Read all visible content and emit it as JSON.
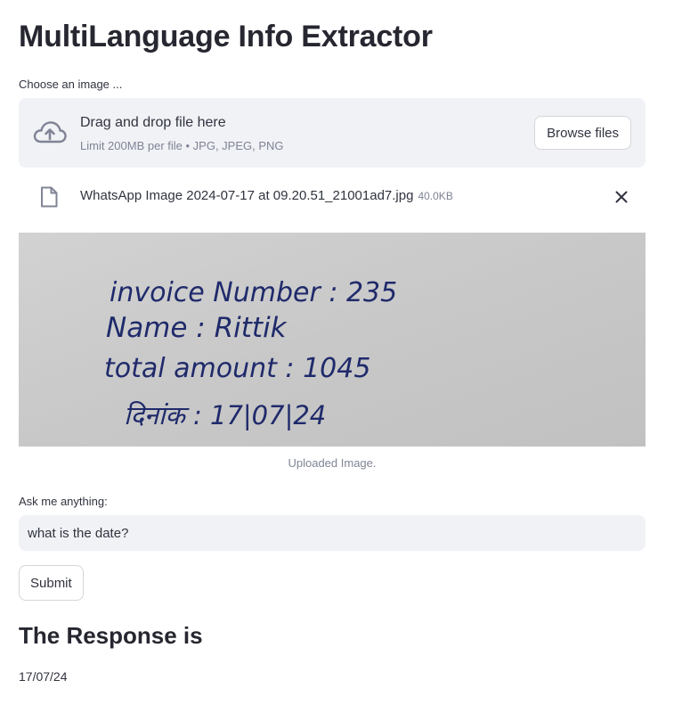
{
  "header": {
    "title": "MultiLanguage Info Extractor"
  },
  "uploader": {
    "label": "Choose an image ...",
    "drag_text": "Drag and drop file here",
    "limit_text": "Limit 200MB per file • JPG, JPEG, PNG",
    "browse_label": "Browse files",
    "cloud_icon": "cloud-upload-icon"
  },
  "uploaded_file": {
    "name": "WhatsApp Image 2024-07-17 at 09.20.51_21001ad7.jpg",
    "size": "40.0KB",
    "file_icon": "file-icon",
    "remove_icon": "close-icon"
  },
  "image": {
    "caption": "Uploaded Image.",
    "handwritten_lines": [
      "invoice Number : 235",
      "Name : Rittik",
      "total amount : 1045",
      "दिनांक : 17|07|24"
    ]
  },
  "question": {
    "label": "Ask me anything:",
    "value": "what is the date?"
  },
  "submit": {
    "label": "Submit"
  },
  "response": {
    "heading": "The Response is",
    "text": "17/07/24"
  },
  "colors": {
    "dropzone_bg": "#f0f2f6",
    "text": "#31333f",
    "muted": "#808495",
    "ink": "#1f2a6b",
    "paper": "#c9c9c9"
  }
}
